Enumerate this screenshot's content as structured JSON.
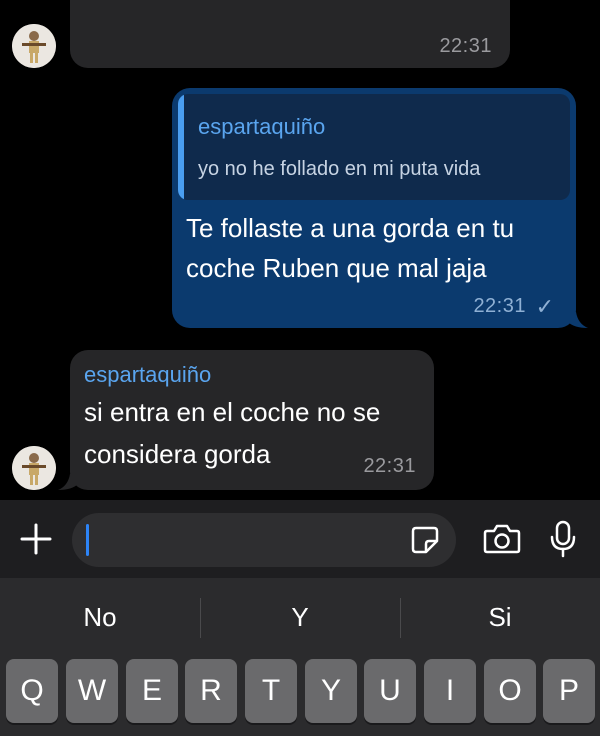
{
  "messages": [
    {
      "time": "22:31"
    },
    {
      "quote_sender": "espartaquiño",
      "quote_text": "yo no he follado en mi puta vida",
      "text_line1": "Te follaste a una gorda en tu",
      "text_line2": "coche Ruben que mal jaja",
      "time": "22:31",
      "status": "✓"
    },
    {
      "sender": "espartaquiño",
      "text_line1": "si entra en el coche no se",
      "text_line2": "considera gorda",
      "time": "22:31"
    }
  ],
  "input": {
    "placeholder": ""
  },
  "suggestions": [
    "No",
    "Y",
    "Si"
  ],
  "keys": [
    "Q",
    "W",
    "E",
    "R",
    "T",
    "Y",
    "U",
    "I",
    "O",
    "P"
  ],
  "colors": {
    "outgoing": "#0b3a6e",
    "incoming": "#262628",
    "accent": "#5aa5ef"
  }
}
